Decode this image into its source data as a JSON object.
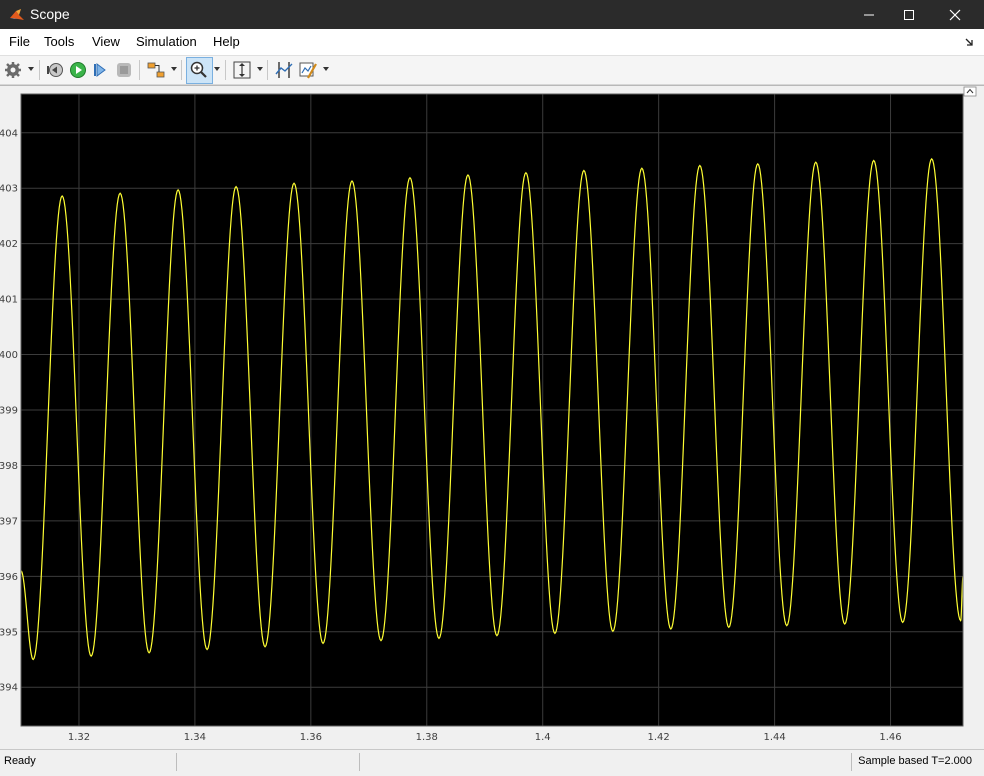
{
  "window": {
    "title": "Scope"
  },
  "menu": {
    "items": [
      "File",
      "Tools",
      "View",
      "Simulation",
      "Help"
    ]
  },
  "toolbar": {
    "buttons": [
      "settings-icon",
      "step-back-icon",
      "run-icon",
      "step-forward-icon",
      "stop-icon",
      "highlight-icon",
      "zoom-in-icon",
      "scale-axes-icon",
      "cursor-measure-icon",
      "style-icon"
    ]
  },
  "status": {
    "left": "Ready",
    "right": "Sample based  T=2.000"
  },
  "colors": {
    "trace": "#ffff33",
    "plot_background": "#000000",
    "grid": "#3c3c3c",
    "titlebar": "#2b2b2b"
  },
  "chart_data": {
    "type": "line",
    "title": "",
    "xlabel": "",
    "ylabel": "",
    "xlim": [
      1.31,
      1.4725
    ],
    "ylim": [
      393.3,
      404.7
    ],
    "xticks": [
      "1.32",
      "1.34",
      "1.36",
      "1.38",
      "1.4",
      "1.42",
      "1.44",
      "1.46"
    ],
    "yticks": [
      "394",
      "395",
      "396",
      "397",
      "398",
      "399",
      "400",
      "401",
      "402",
      "403",
      "404"
    ],
    "grid": true,
    "series": [
      {
        "color": "#ffff33",
        "period": 0.01,
        "peaks": [
          [
            1.3171,
            402.86
          ],
          [
            1.3271,
            402.91
          ],
          [
            1.3371,
            402.97
          ],
          [
            1.3471,
            403.03
          ],
          [
            1.3571,
            403.09
          ],
          [
            1.3671,
            403.13
          ],
          [
            1.3771,
            403.19
          ],
          [
            1.3871,
            403.24
          ],
          [
            1.3971,
            403.28
          ],
          [
            1.4071,
            403.32
          ],
          [
            1.4171,
            403.36
          ],
          [
            1.4271,
            403.41
          ],
          [
            1.4371,
            403.44
          ],
          [
            1.4471,
            403.47
          ],
          [
            1.4571,
            403.5
          ],
          [
            1.4671,
            403.53
          ]
        ],
        "troughs": [
          [
            1.3121,
            394.5
          ],
          [
            1.3221,
            394.56
          ],
          [
            1.3321,
            394.62
          ],
          [
            1.3421,
            394.68
          ],
          [
            1.3521,
            394.73
          ],
          [
            1.3621,
            394.79
          ],
          [
            1.3721,
            394.84
          ],
          [
            1.3821,
            394.88
          ],
          [
            1.3921,
            394.93
          ],
          [
            1.4021,
            394.97
          ],
          [
            1.4121,
            395.01
          ],
          [
            1.4221,
            395.05
          ],
          [
            1.4321,
            395.08
          ],
          [
            1.4421,
            395.11
          ],
          [
            1.4521,
            395.14
          ],
          [
            1.4621,
            395.17
          ],
          [
            1.4721,
            395.2
          ]
        ]
      }
    ]
  }
}
